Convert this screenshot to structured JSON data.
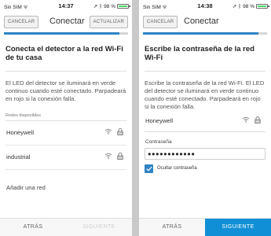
{
  "colors": {
    "accent": "#2f83c5",
    "primary_button": "#118fd6",
    "battery": "#4cd964"
  },
  "screen1": {
    "status": {
      "carrier": "Sin SIM",
      "time": "14:37",
      "battery": "98 %"
    },
    "nav": {
      "cancel": "CANCELAR",
      "title": "Conectar",
      "update": "ACTUALIZAR"
    },
    "progress": 0.93,
    "heading": "Conecta el detector a la red Wi-Fi de tu casa",
    "description": "El LED del detector se iluminará en verde continuo cuando esté conectado. Parpadeará en rojo si la conexión falla.",
    "networks_label": "Redes disponibles",
    "networks": [
      {
        "name": "Honeywell",
        "icons": [
          "wifi-icon",
          "lock-icon"
        ]
      },
      {
        "name": "industrial",
        "icons": [
          "wifi-icon",
          "lock-icon"
        ]
      }
    ],
    "add_network": "Añadir una red",
    "footer": {
      "back": "ATRÁS",
      "next": "SIGUIENTE"
    }
  },
  "screen2": {
    "status": {
      "carrier": "Sin SIM",
      "time": "14:38",
      "battery": "98 %"
    },
    "nav": {
      "cancel": "CANCELAR",
      "title": "Conectar"
    },
    "progress": 0.93,
    "heading": "Escribe la contraseña de la red Wi-Fi",
    "description": "Escribe la contraseña de la red Wi-Fi. El LED del detector se iluminará en verde continuo cuando esté conectado. Parpadeará en rojo si la conexión falla.",
    "network": "Honeywell",
    "password_label": "Contraseña",
    "password_value": "●●●●●●●●●●●●",
    "hide_password_label": "Ocultar contraseña",
    "hide_password_checked": true,
    "footer": {
      "back": "ATRÁS",
      "next": "SIGUIENTE"
    }
  }
}
